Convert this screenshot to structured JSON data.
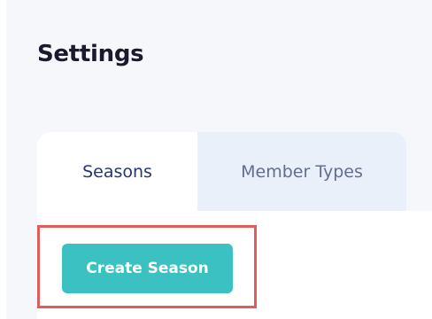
{
  "page": {
    "title": "Settings"
  },
  "tabs": [
    {
      "label": "Seasons",
      "active": true
    },
    {
      "label": "Member Types",
      "active": false
    }
  ],
  "actions": {
    "create_season_label": "Create Season"
  },
  "colors": {
    "page_background": "#f5f7fb",
    "title_text": "#1a1a2e",
    "active_tab_text": "#263674",
    "inactive_tab_text": "#5f6f8c",
    "inactive_tab_background": "#eaf0fa",
    "button_background": "#3cc1c2",
    "highlight_border": "#e35b5b"
  }
}
